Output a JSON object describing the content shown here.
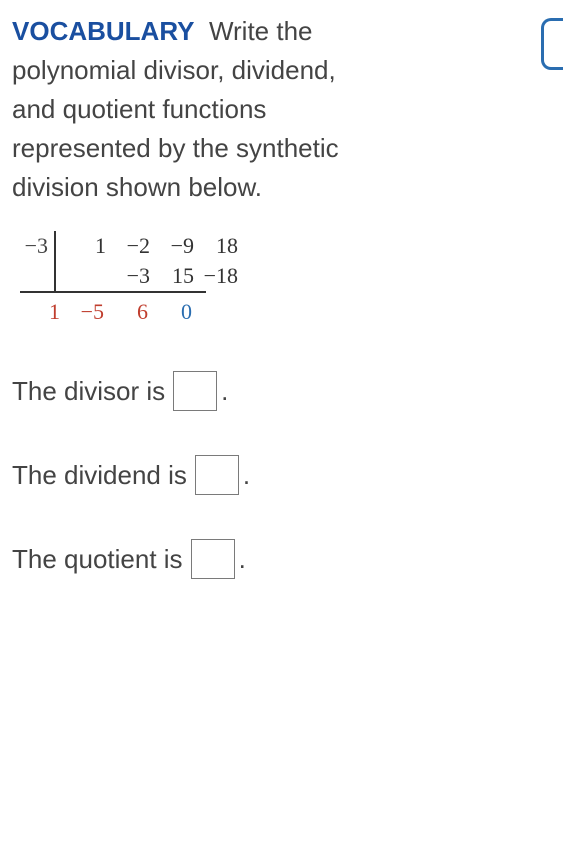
{
  "heading_label": "VOCABULARY",
  "prompt_text": "Write the polynomial divisor, dividend, and quotient functions represented by the synthetic division shown below.",
  "synthetic": {
    "k": "−3",
    "row1": [
      "1",
      "−2",
      "−9",
      "18"
    ],
    "row2": [
      "",
      "−3",
      "15",
      "−18"
    ],
    "row3": [
      "1",
      "−5",
      "6",
      "0"
    ]
  },
  "answers": {
    "divisor_label_pre": "The divisor is ",
    "dividend_label_pre": "The dividend is ",
    "quotient_label_pre": "The quotient is ",
    "period": ".",
    "divisor_value": "",
    "dividend_value": "",
    "quotient_value": ""
  }
}
